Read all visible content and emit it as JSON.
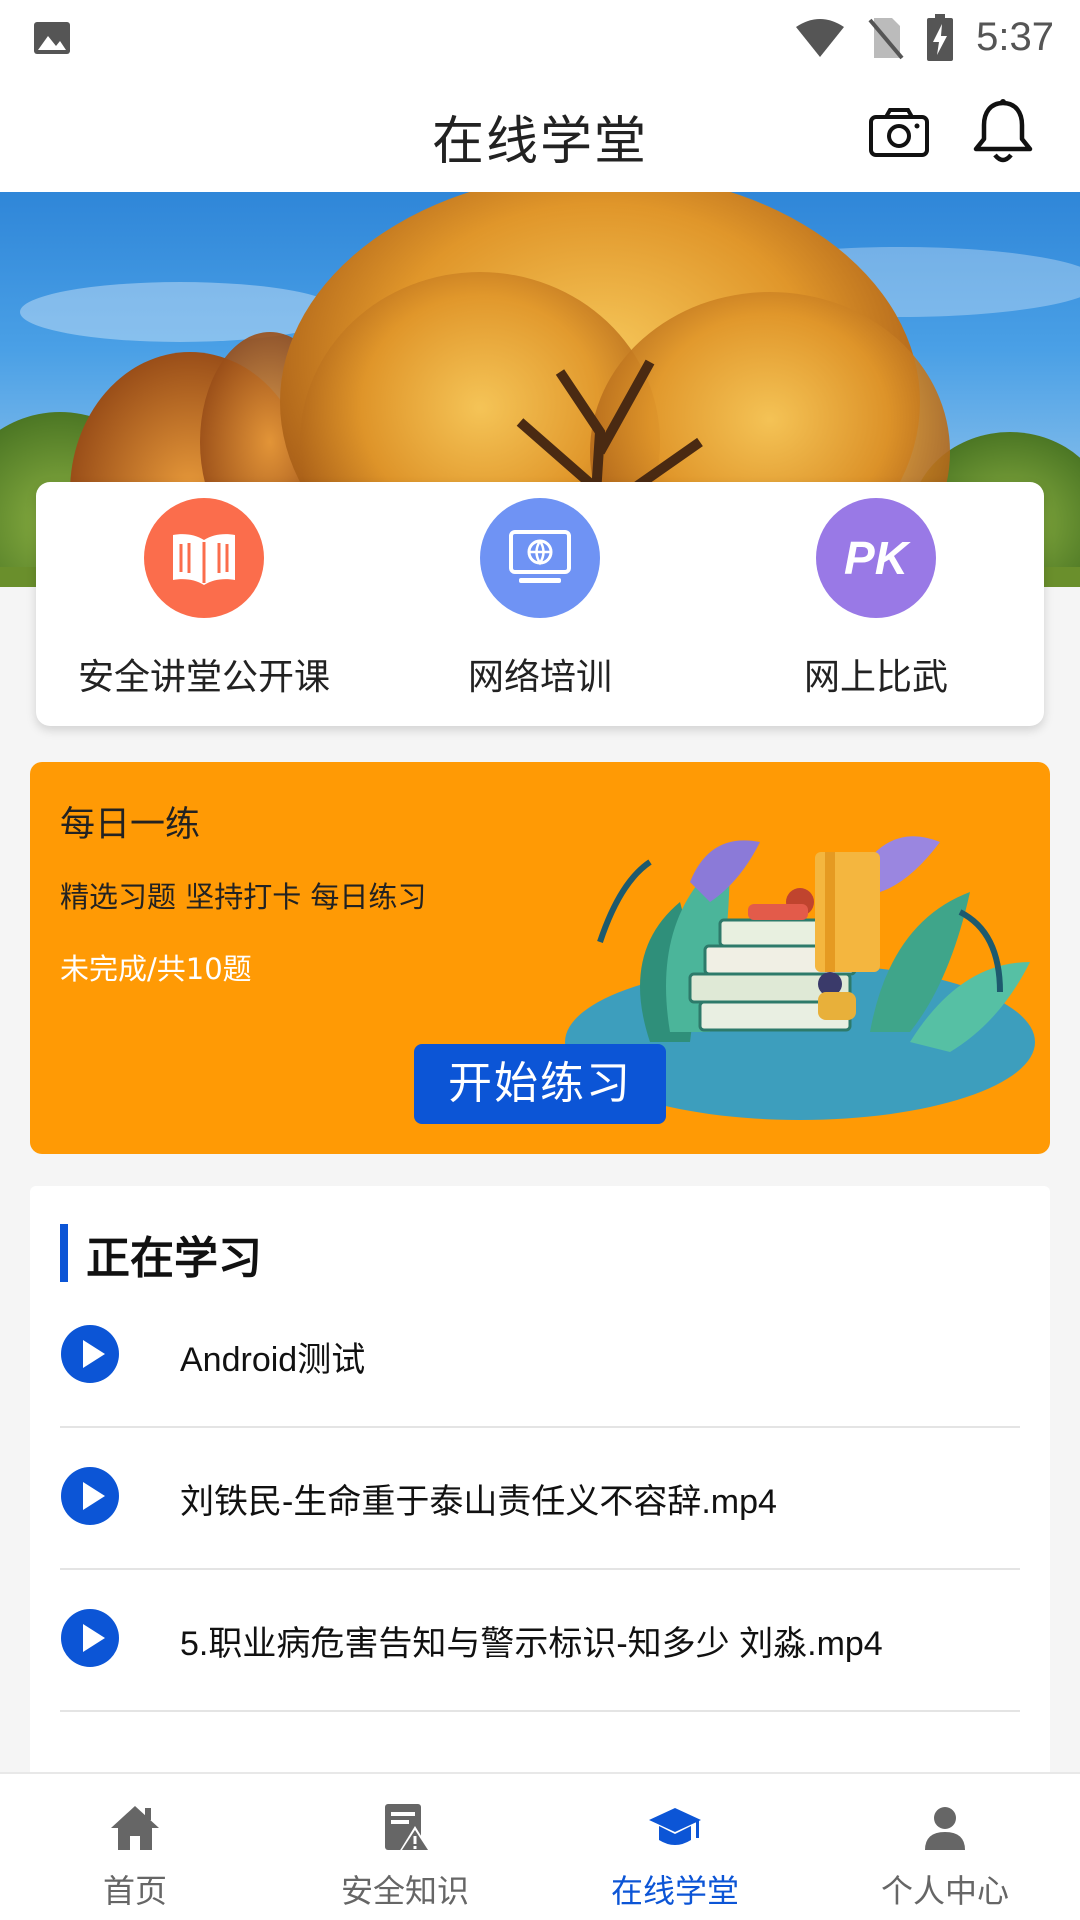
{
  "status_bar": {
    "time": "5:37",
    "icons": [
      "image-icon",
      "wifi-icon",
      "no-sim-icon",
      "battery-charging-icon"
    ]
  },
  "app_bar": {
    "title": "在线学堂",
    "icons": [
      "camera-icon",
      "bell-icon"
    ]
  },
  "quick_menu": [
    {
      "label": "安全讲堂公开课",
      "icon": "book-icon",
      "color": "#fb6d4c"
    },
    {
      "label": "网络培训",
      "icon": "computer-globe-icon",
      "color": "#6f93f4"
    },
    {
      "label": "网上比武",
      "icon": "pk-icon",
      "icon_text": "PK",
      "color": "#9979e6"
    }
  ],
  "daily": {
    "title": "每日一练",
    "subtitle": "精选习题 坚持打卡 每日练习",
    "status": "未完成/共10题",
    "button": "开始练习",
    "background": "#ff9a05"
  },
  "learning": {
    "header": "正在学习",
    "items": [
      {
        "title": "Android测试"
      },
      {
        "title": "刘铁民-生命重于泰山责任义不容辞.mp4"
      },
      {
        "title": "5.职业病危害告知与警示标识-知多少 刘淼.mp4"
      }
    ]
  },
  "bottom_nav": [
    {
      "label": "首页",
      "icon": "home-icon",
      "active": false
    },
    {
      "label": "安全知识",
      "icon": "knowledge-icon",
      "active": false
    },
    {
      "label": "在线学堂",
      "icon": "graduation-cap-icon",
      "active": true
    },
    {
      "label": "个人中心",
      "icon": "person-icon",
      "active": false
    }
  ],
  "colors": {
    "accent": "#0c55d6",
    "inactive": "#666666"
  }
}
